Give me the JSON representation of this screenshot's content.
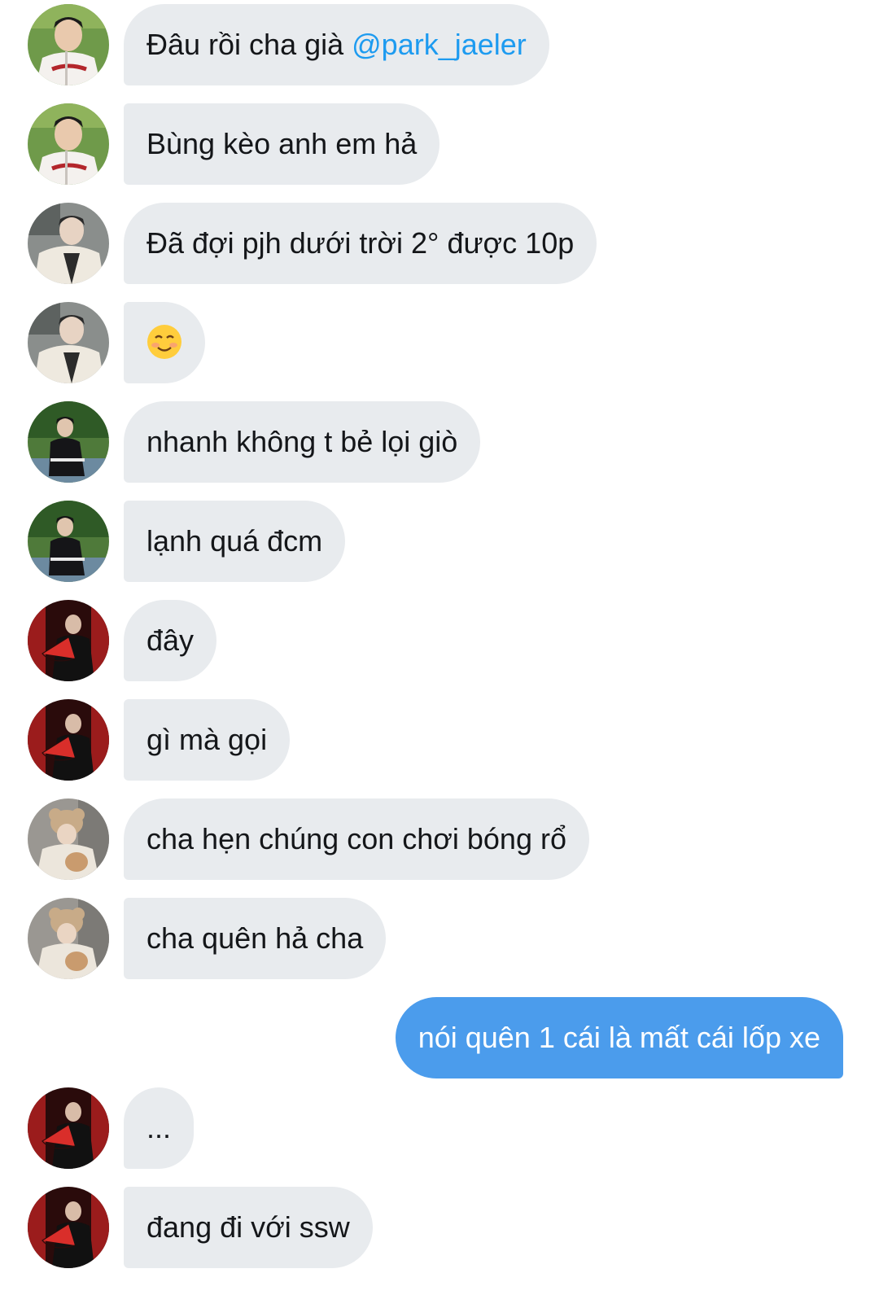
{
  "messages": [
    {
      "avatar": "avatar-baseball-jersey",
      "text": "Đâu rồi cha già ",
      "mention": "@park_jaeler"
    },
    {
      "avatar": "avatar-baseball-jersey",
      "text": "Bùng kèo anh em hả"
    },
    {
      "avatar": "avatar-white-fleece",
      "text": "Đã đợi pjh dưới trời 2° được 10p"
    },
    {
      "avatar": "avatar-white-fleece",
      "text": "☺️",
      "emoji": "smiling-face-emoji"
    },
    {
      "avatar": "avatar-park-trees",
      "text": "nhanh không t bẻ lọi giò"
    },
    {
      "avatar": "avatar-park-trees",
      "text": "lạnh quá đcm"
    },
    {
      "avatar": "avatar-red-fan",
      "text": "đây"
    },
    {
      "avatar": "avatar-red-fan",
      "text": "gì mà gọi"
    },
    {
      "avatar": "avatar-bear-hat",
      "text": "cha hẹn chúng con chơi bóng rổ"
    },
    {
      "avatar": "avatar-bear-hat",
      "text": "cha quên hả cha"
    },
    {
      "outgoing": true,
      "text": "nói quên 1 cái là mất cái lốp xe"
    },
    {
      "avatar": "avatar-red-fan",
      "text": "..."
    },
    {
      "avatar": "avatar-red-fan",
      "text": "đang đi với ssw"
    }
  ],
  "colors": {
    "incoming_bubble": "#e8ebee",
    "outgoing_bubble": "#4b9cec",
    "mention": "#1d9bf0",
    "text": "#141619"
  }
}
